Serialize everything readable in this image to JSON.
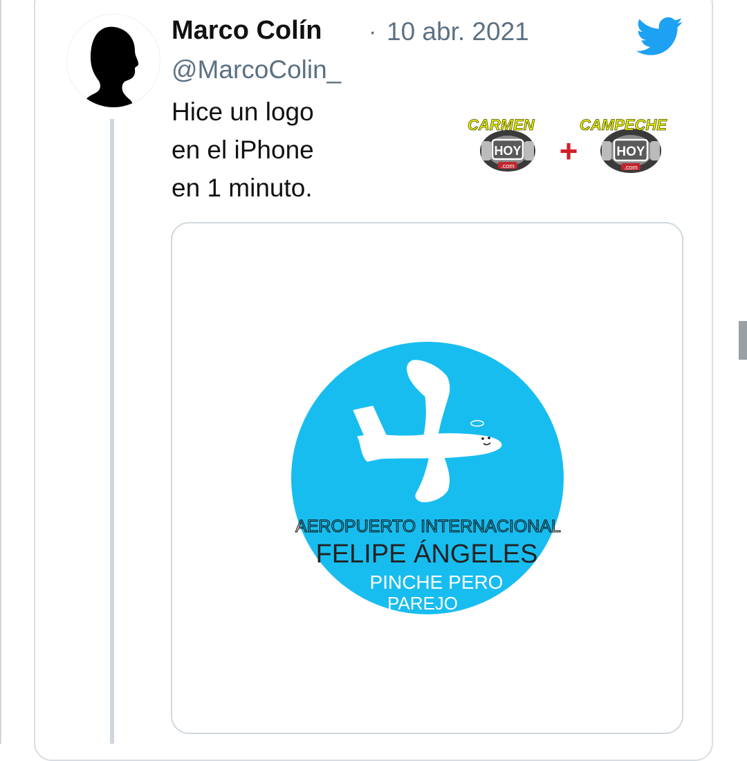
{
  "tweet": {
    "author_name": "Marco Colín",
    "separator": "·",
    "date": "10 abr. 2021",
    "handle": "@MarcoColin_",
    "text_lines": [
      "Hice un logo",
      "en el iPhone",
      "en 1 minuto."
    ]
  },
  "icons": {
    "brand": "twitter-bird-icon",
    "avatar": "user-silhouette"
  },
  "watermark": {
    "left_word": "CARMEN",
    "right_word": "CAMPECHE",
    "badge_text": "HOY",
    "badge_sub": ".com",
    "plus": "+"
  },
  "media_logo": {
    "line1": "AEROPUERTO INTERNACIONAL",
    "line2": "FELIPE ÁNGELES",
    "line3": "PINCHE PERO",
    "line4": "PAREJO"
  },
  "colors": {
    "twitter_blue": "#1da1f2",
    "logo_circle": "#18bdf0",
    "muted_text": "#5b7083",
    "watermark_yellow": "#e6f000",
    "watermark_red": "#d0202a"
  }
}
